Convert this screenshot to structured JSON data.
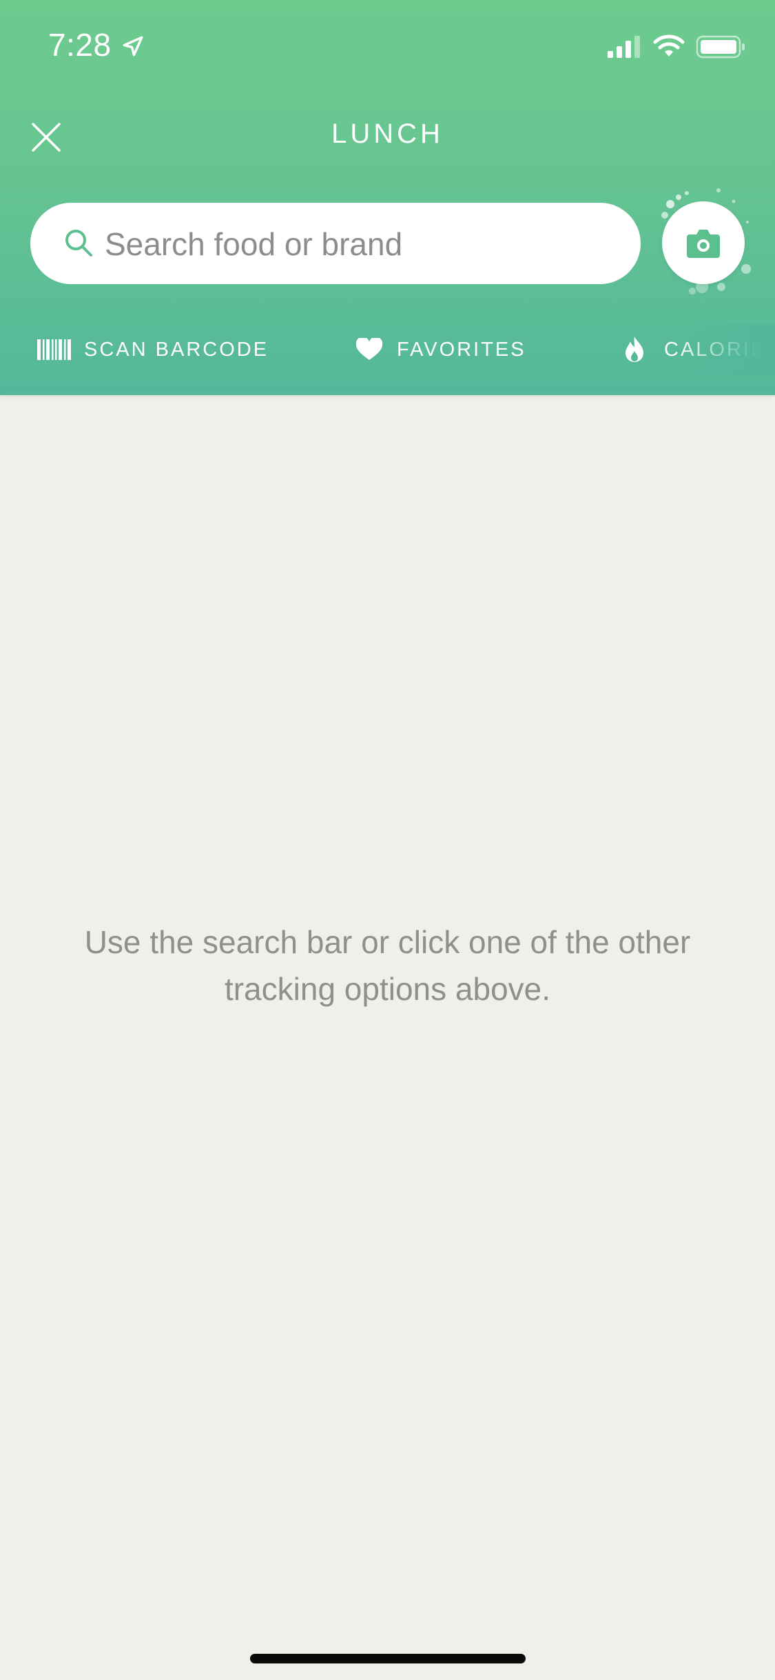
{
  "status_bar": {
    "time": "7:28"
  },
  "header": {
    "title": "LUNCH"
  },
  "search": {
    "placeholder": "Search food or brand",
    "value": ""
  },
  "quick_actions": [
    {
      "label": "SCAN BARCODE",
      "icon": "barcode-icon"
    },
    {
      "label": "FAVORITES",
      "icon": "heart-icon"
    },
    {
      "label": "CALORIES",
      "icon": "flame-icon"
    }
  ],
  "empty_state": {
    "message": "Use the search bar or click one of the other tracking options above."
  },
  "colors": {
    "header_top": "#6ecb8e",
    "header_bottom": "#53b79a",
    "accent_green": "#5cbf8e",
    "background": "#f0efe9",
    "empty_text": "#8f8f8f"
  }
}
